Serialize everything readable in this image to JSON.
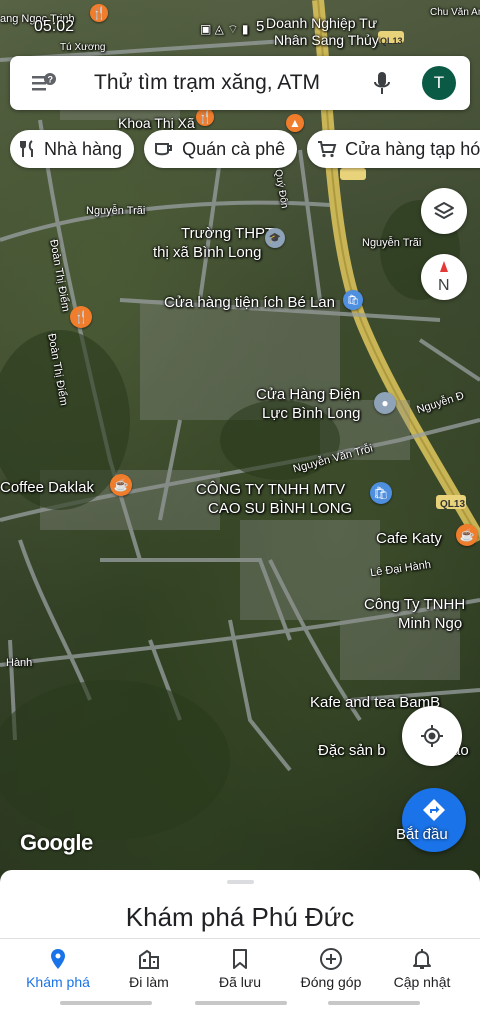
{
  "status": {
    "time": "05:02",
    "battery": "5"
  },
  "search": {
    "placeholder": "Thử tìm trạm xăng, ATM",
    "avatar_letter": "T"
  },
  "chips": [
    "Nhà hàng",
    "Quán cà phê",
    "Cửa hàng tạp hóa"
  ],
  "map": {
    "places": [
      "ang Ngọc Trinh",
      "Doanh Nghiệp Tư",
      "Nhân Sang Thủy",
      "Chu Văn An",
      "Tú Xương",
      "QL13",
      "Khoa Thị Xã",
      "Quý Đôn",
      "Nguyễn Trãi",
      "Trường THPT",
      "thị xã Bình Long",
      "Nguyễn Trãi",
      "Đoàn Thị Điểm",
      "Cửa hàng tiện ích Bé Lan",
      "Đoàn Thị Điểm",
      "Cửa Hàng Điện",
      "Lực Bình Long",
      "Nguyễn Đ",
      "Nguyễn Văn Trỗi",
      "Coffee Daklak",
      "CÔNG TY TNHH MTV",
      "CAO SU BÌNH LONG",
      "QL13",
      "Cafe Katy",
      "Lê Đại Hành",
      "Công Ty TNHH",
      "Minh Ngọ",
      "Hành",
      "Kafe and tea BamB",
      "Đặc sản b",
      "ao"
    ],
    "brand": "Google"
  },
  "start_button": {
    "label": "Bắt đầu"
  },
  "sheet": {
    "title": "Khám phá Phú Đức"
  },
  "nav": [
    {
      "label": "Khám phá",
      "icon": "pin-icon",
      "active": true
    },
    {
      "label": "Đi làm",
      "icon": "commute-icon",
      "active": false
    },
    {
      "label": "Đã lưu",
      "icon": "bookmark-icon",
      "active": false
    },
    {
      "label": "Đóng góp",
      "icon": "add-circle-icon",
      "active": false
    },
    {
      "label": "Cập nhật",
      "icon": "bell-icon",
      "active": false
    }
  ],
  "colors": {
    "accent": "#1a73e8",
    "road": "#d8c15a",
    "poi_orange": "#f07d2c",
    "poi_blue": "#4f8fe0"
  }
}
